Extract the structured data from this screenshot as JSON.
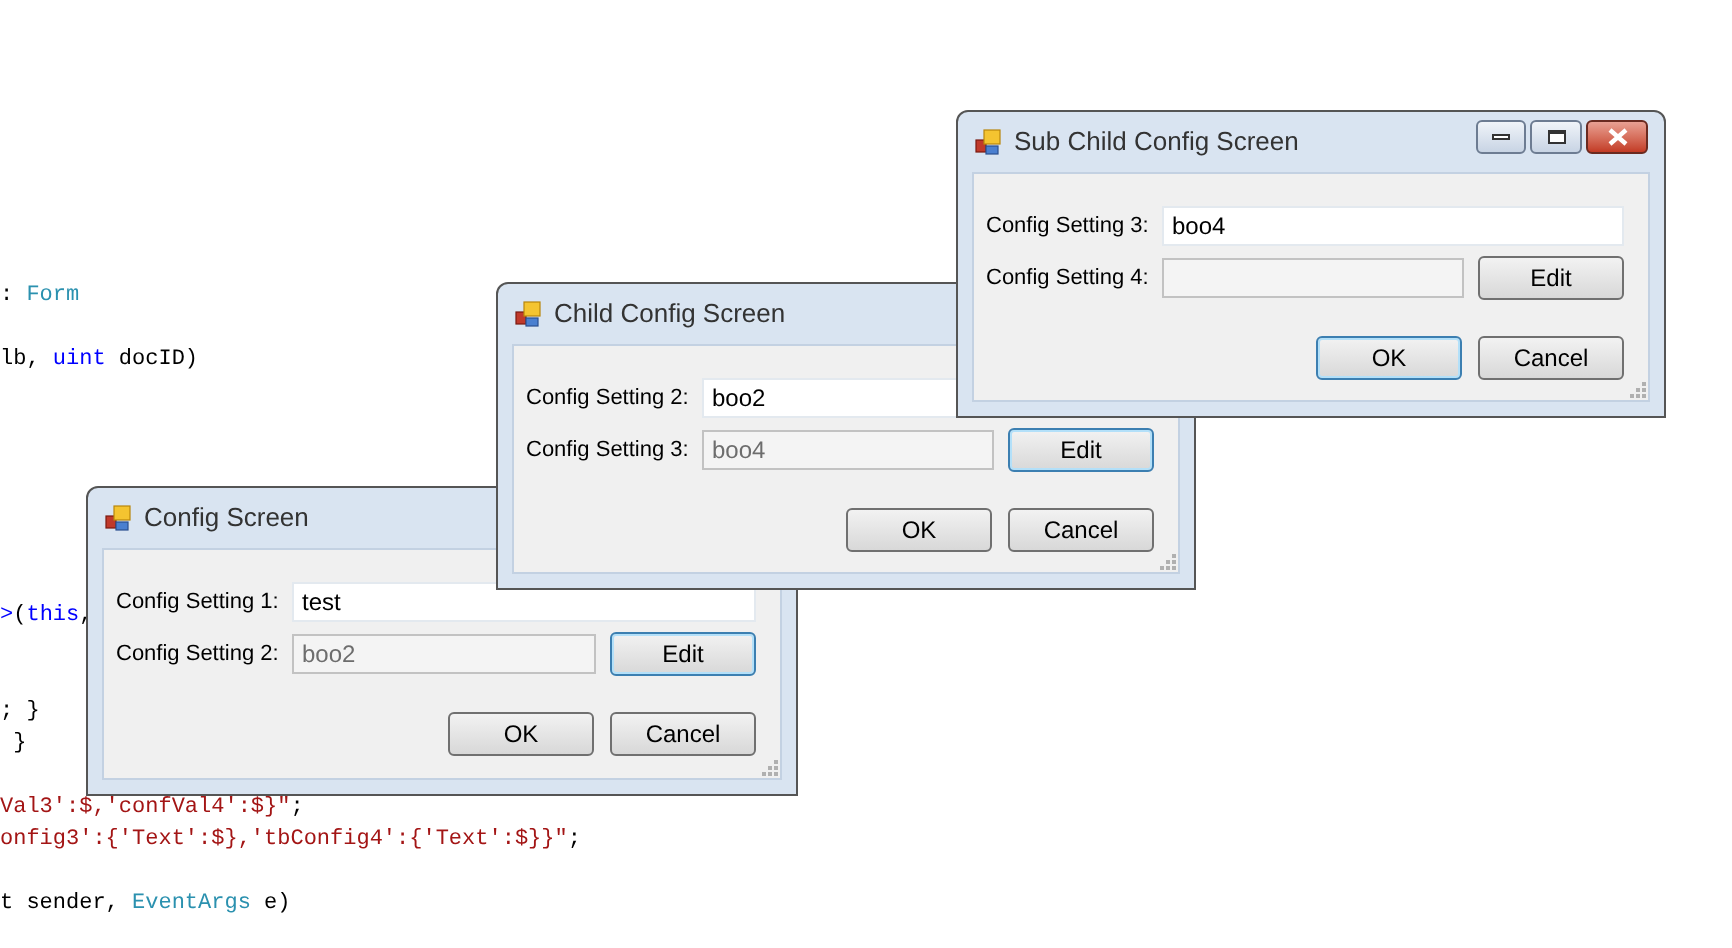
{
  "code_lines": [
    {
      "kind": "code",
      "segments": [
        {
          "text": ": ",
          "kind": "plain"
        },
        {
          "text": "Form",
          "kind": "type"
        }
      ]
    },
    {
      "kind": "blank"
    },
    {
      "kind": "code",
      "segments": [
        {
          "text": "lb, ",
          "kind": "plain"
        },
        {
          "text": "uint",
          "kind": "keyword"
        },
        {
          "text": " docID)",
          "kind": "plain"
        }
      ]
    },
    {
      "kind": "blank"
    },
    {
      "kind": "blank"
    },
    {
      "kind": "blank"
    },
    {
      "kind": "blank"
    },
    {
      "kind": "blank"
    },
    {
      "kind": "blank"
    },
    {
      "kind": "blank"
    },
    {
      "kind": "code",
      "segments": [
        {
          "text": ">",
          "kind": "keyword"
        },
        {
          "text": "(",
          "kind": "plain"
        },
        {
          "text": "this",
          "kind": "keyword"
        },
        {
          "text": ",",
          "kind": "plain"
        }
      ]
    },
    {
      "kind": "blank"
    },
    {
      "kind": "blank"
    },
    {
      "kind": "code",
      "segments": [
        {
          "text": "; }",
          "kind": "plain"
        }
      ]
    },
    {
      "kind": "code",
      "segments": [
        {
          "text": " }",
          "kind": "plain"
        }
      ]
    },
    {
      "kind": "blank"
    },
    {
      "kind": "code",
      "segments": [
        {
          "text": "Val3':$,'confVal4':$}\"",
          "kind": "string"
        },
        {
          "text": ";",
          "kind": "plain"
        }
      ]
    },
    {
      "kind": "code",
      "segments": [
        {
          "text": "onfig3':{'Text':$},'tbConfig4':{'Text':$}}\"",
          "kind": "string"
        },
        {
          "text": ";",
          "kind": "plain"
        }
      ]
    },
    {
      "kind": "blank"
    },
    {
      "kind": "code",
      "segments": [
        {
          "text": "t sender, ",
          "kind": "plain"
        },
        {
          "text": "EventArgs",
          "kind": "type"
        },
        {
          "text": " e)",
          "kind": "plain"
        }
      ]
    }
  ],
  "dialogs": [
    {
      "title": "Config Screen",
      "fields": [
        {
          "label": "Config Setting 1:",
          "value": "test",
          "disabled": false
        },
        {
          "label": "Config Setting 2:",
          "value": "boo2",
          "disabled": true,
          "edit_button": {
            "label": "Edit",
            "focused": true
          }
        }
      ],
      "buttons": [
        {
          "label": "OK",
          "focused": false
        },
        {
          "label": "Cancel",
          "focused": false
        }
      ]
    },
    {
      "title": "Child Config Screen",
      "fields": [
        {
          "label": "Config Setting 2:",
          "value": "boo2",
          "disabled": false
        },
        {
          "label": "Config Setting 3:",
          "value": "boo4",
          "disabled": true,
          "edit_button": {
            "label": "Edit",
            "focused": true
          }
        }
      ],
      "buttons": [
        {
          "label": "OK",
          "focused": false
        },
        {
          "label": "Cancel",
          "focused": false
        }
      ]
    },
    {
      "title": "Sub Child Config Screen",
      "window_controls": [
        {
          "kind": "minimize"
        },
        {
          "kind": "maximize"
        },
        {
          "kind": "close"
        }
      ],
      "fields": [
        {
          "label": "Config Setting 3:",
          "value": "boo4",
          "disabled": false
        },
        {
          "label": "Config Setting 4:",
          "disabled": true,
          "edit_button": {
            "label": "Edit",
            "focused": false
          }
        }
      ],
      "buttons": [
        {
          "label": "OK",
          "focused": true
        },
        {
          "label": "Cancel",
          "focused": false
        }
      ]
    }
  ]
}
